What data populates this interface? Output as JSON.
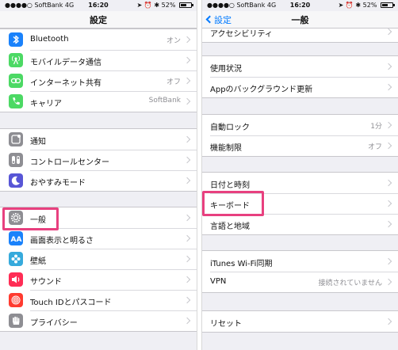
{
  "colors": {
    "accent": "#007aff",
    "highlight": "#e8407f",
    "bluetooth_icon": "#1a82fb",
    "cellular_icon": "#4cd964",
    "hotspot_icon": "#4cd964",
    "carrier_icon": "#4cd964",
    "notifications_icon": "#8e8e93",
    "control_center_icon": "#8e8e93",
    "dnd_icon": "#5856d6",
    "general_icon": "#8e8e93",
    "display_icon": "#1a82fb",
    "wallpaper_icon": "#36aadc",
    "sounds_icon": "#ff2d55",
    "touchid_icon": "#ff3b30",
    "privacy_icon": "#8e8e93"
  },
  "left": {
    "status": {
      "carrier": "SoftBank",
      "network": "4G",
      "time": "16:20",
      "battery": "52%"
    },
    "nav_title": "設定",
    "group1": [
      {
        "label": "Bluetooth",
        "value": "オン",
        "icon": "bluetooth-icon"
      },
      {
        "label": "モバイルデータ通信",
        "value": "",
        "icon": "antenna-icon"
      },
      {
        "label": "インターネット共有",
        "value": "オフ",
        "icon": "link-icon"
      },
      {
        "label": "キャリア",
        "value": "SoftBank",
        "icon": "phone-icon"
      }
    ],
    "group2": [
      {
        "label": "通知",
        "value": "",
        "icon": "notification-icon"
      },
      {
        "label": "コントロールセンター",
        "value": "",
        "icon": "toggles-icon"
      },
      {
        "label": "おやすみモード",
        "value": "",
        "icon": "moon-icon"
      }
    ],
    "group3": [
      {
        "label": "一般",
        "value": "",
        "icon": "gear-icon"
      },
      {
        "label": "画面表示と明るさ",
        "value": "",
        "icon": "text-size-icon"
      },
      {
        "label": "壁紙",
        "value": "",
        "icon": "flower-icon"
      },
      {
        "label": "サウンド",
        "value": "",
        "icon": "speaker-icon"
      },
      {
        "label": "Touch IDとパスコード",
        "value": "",
        "icon": "fingerprint-icon"
      },
      {
        "label": "プライバシー",
        "value": "",
        "icon": "hand-icon"
      }
    ]
  },
  "right": {
    "status": {
      "carrier": "SoftBank",
      "network": "4G",
      "time": "16:20",
      "battery": "52%"
    },
    "back_label": "設定",
    "nav_title": "一般",
    "group0": [
      {
        "label": "アクセシビリティ",
        "value": ""
      }
    ],
    "group1": [
      {
        "label": "使用状況",
        "value": ""
      },
      {
        "label": "Appのバックグラウンド更新",
        "value": ""
      }
    ],
    "group2": [
      {
        "label": "自動ロック",
        "value": "1分"
      },
      {
        "label": "機能制限",
        "value": "オフ"
      }
    ],
    "group3": [
      {
        "label": "日付と時刻",
        "value": ""
      },
      {
        "label": "キーボード",
        "value": ""
      },
      {
        "label": "言語と地域",
        "value": ""
      }
    ],
    "group4": [
      {
        "label": "iTunes Wi-Fi同期",
        "value": ""
      },
      {
        "label": "VPN",
        "value": "接続されていません"
      }
    ],
    "group5": [
      {
        "label": "リセット",
        "value": ""
      }
    ]
  }
}
